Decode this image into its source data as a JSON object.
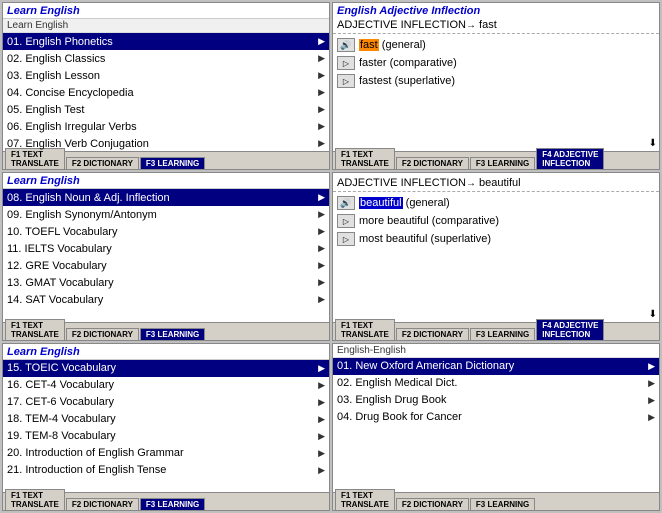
{
  "panels": {
    "top_left": {
      "title": "Learn English",
      "subtitle": "Learn English",
      "items": [
        {
          "num": "01.",
          "text": "English Phonetics",
          "selected": true
        },
        {
          "num": "02.",
          "text": "English Classics",
          "selected": false
        },
        {
          "num": "03.",
          "text": "English Lesson",
          "selected": false
        },
        {
          "num": "04.",
          "text": "Concise Encyclopedia",
          "selected": false
        },
        {
          "num": "05.",
          "text": "English Test",
          "selected": false
        },
        {
          "num": "06.",
          "text": "English Irregular Verbs",
          "selected": false
        },
        {
          "num": "07.",
          "text": "English Verb Conjugation",
          "selected": false
        }
      ],
      "tabs": [
        {
          "label": "F1 TEXT TRANSLATE",
          "active": false
        },
        {
          "label": "F2 DICTIONARY",
          "active": false
        },
        {
          "label": "F3 LEARNING",
          "active": true
        }
      ]
    },
    "mid_left": {
      "title": "Learn English",
      "subtitle": "",
      "items": [
        {
          "num": "08.",
          "text": "English Noun & Adj. Inflection",
          "selected": true
        },
        {
          "num": "09.",
          "text": "English Synonym/Antonym",
          "selected": false
        },
        {
          "num": "10.",
          "text": "TOEFL Vocabulary",
          "selected": false
        },
        {
          "num": "11.",
          "text": "IELTS Vocabulary",
          "selected": false
        },
        {
          "num": "12.",
          "text": "GRE Vocabulary",
          "selected": false
        },
        {
          "num": "13.",
          "text": "GMAT Vocabulary",
          "selected": false
        },
        {
          "num": "14.",
          "text": "SAT Vocabulary",
          "selected": false
        }
      ],
      "tabs": [
        {
          "label": "F1 TEXT TRANSLATE",
          "active": false
        },
        {
          "label": "F2 DICTIONARY",
          "active": false
        },
        {
          "label": "F3 LEARNING",
          "active": true
        }
      ]
    },
    "bot_left": {
      "title": "Learn English",
      "subtitle": "",
      "items": [
        {
          "num": "15.",
          "text": "TOEIC Vocabulary",
          "selected": true
        },
        {
          "num": "16.",
          "text": "CET-4 Vocabulary",
          "selected": false
        },
        {
          "num": "17.",
          "text": "CET-6 Vocabulary",
          "selected": false
        },
        {
          "num": "18.",
          "text": "TEM-4 Vocabulary",
          "selected": false
        },
        {
          "num": "19.",
          "text": "TEM-8 Vocabulary",
          "selected": false
        },
        {
          "num": "20.",
          "text": "Introduction of English Grammar",
          "selected": false
        },
        {
          "num": "21.",
          "text": "Introduction of English Tense",
          "selected": false
        }
      ],
      "tabs": [
        {
          "label": "F1 TEXT TRANSLATE",
          "active": false
        },
        {
          "label": "F2 DICTIONARY",
          "active": false
        },
        {
          "label": "F3 LEARNING",
          "active": true
        }
      ]
    },
    "top_right": {
      "main_title": "English Adjective Inflection",
      "header": "ADJECTIVE INFLECTION",
      "arrow": "→",
      "word": "fast",
      "items": [
        {
          "word_highlight": "fast",
          "suffix": " (general)",
          "type": "general"
        },
        {
          "prefix": "faster",
          "suffix": " (comparative)",
          "type": "comp"
        },
        {
          "prefix": "fastest",
          "suffix": " (superlative)",
          "type": "super"
        }
      ],
      "tabs": [
        {
          "label": "F1 TEXT TRANSLATE",
          "active": false
        },
        {
          "label": "F2 DICTIONARY",
          "active": false
        },
        {
          "label": "F3 LEARNING",
          "active": false
        },
        {
          "label": "F4 ADJECTIVE INFLECTION",
          "active": true
        }
      ]
    },
    "mid_right": {
      "header": "ADJECTIVE INFLECTION",
      "arrow": "→",
      "word": "beautiful",
      "items": [
        {
          "word_highlight": "beautiful",
          "suffix": " (general)",
          "type": "general"
        },
        {
          "prefix": "more beautiful",
          "suffix": " (comparative)",
          "type": "comp"
        },
        {
          "prefix": "most beautiful",
          "suffix": " (superlative)",
          "type": "super"
        }
      ],
      "tabs": [
        {
          "label": "F1 TEXT TRANSLATE",
          "active": false
        },
        {
          "label": "F2 DICTIONARY",
          "active": false
        },
        {
          "label": "F3 LEARNING",
          "active": false
        },
        {
          "label": "F4 ADJECTIVE INFLECTION",
          "active": true
        }
      ]
    },
    "bot_right": {
      "subtitle": "English-English",
      "items": [
        {
          "num": "01.",
          "text": "New Oxford American Dictionary",
          "selected": true
        },
        {
          "num": "02.",
          "text": "English Medical Dict.",
          "selected": false
        },
        {
          "num": "03.",
          "text": "English Drug Book",
          "selected": false
        },
        {
          "num": "04.",
          "text": "Drug Book for Cancer",
          "selected": false
        }
      ],
      "tabs": [
        {
          "label": "F1 TEXT TRANSLATE",
          "active": false
        },
        {
          "label": "F2 DICTIONARY",
          "active": false
        },
        {
          "label": "F3 LEARNING",
          "active": false
        }
      ]
    }
  }
}
